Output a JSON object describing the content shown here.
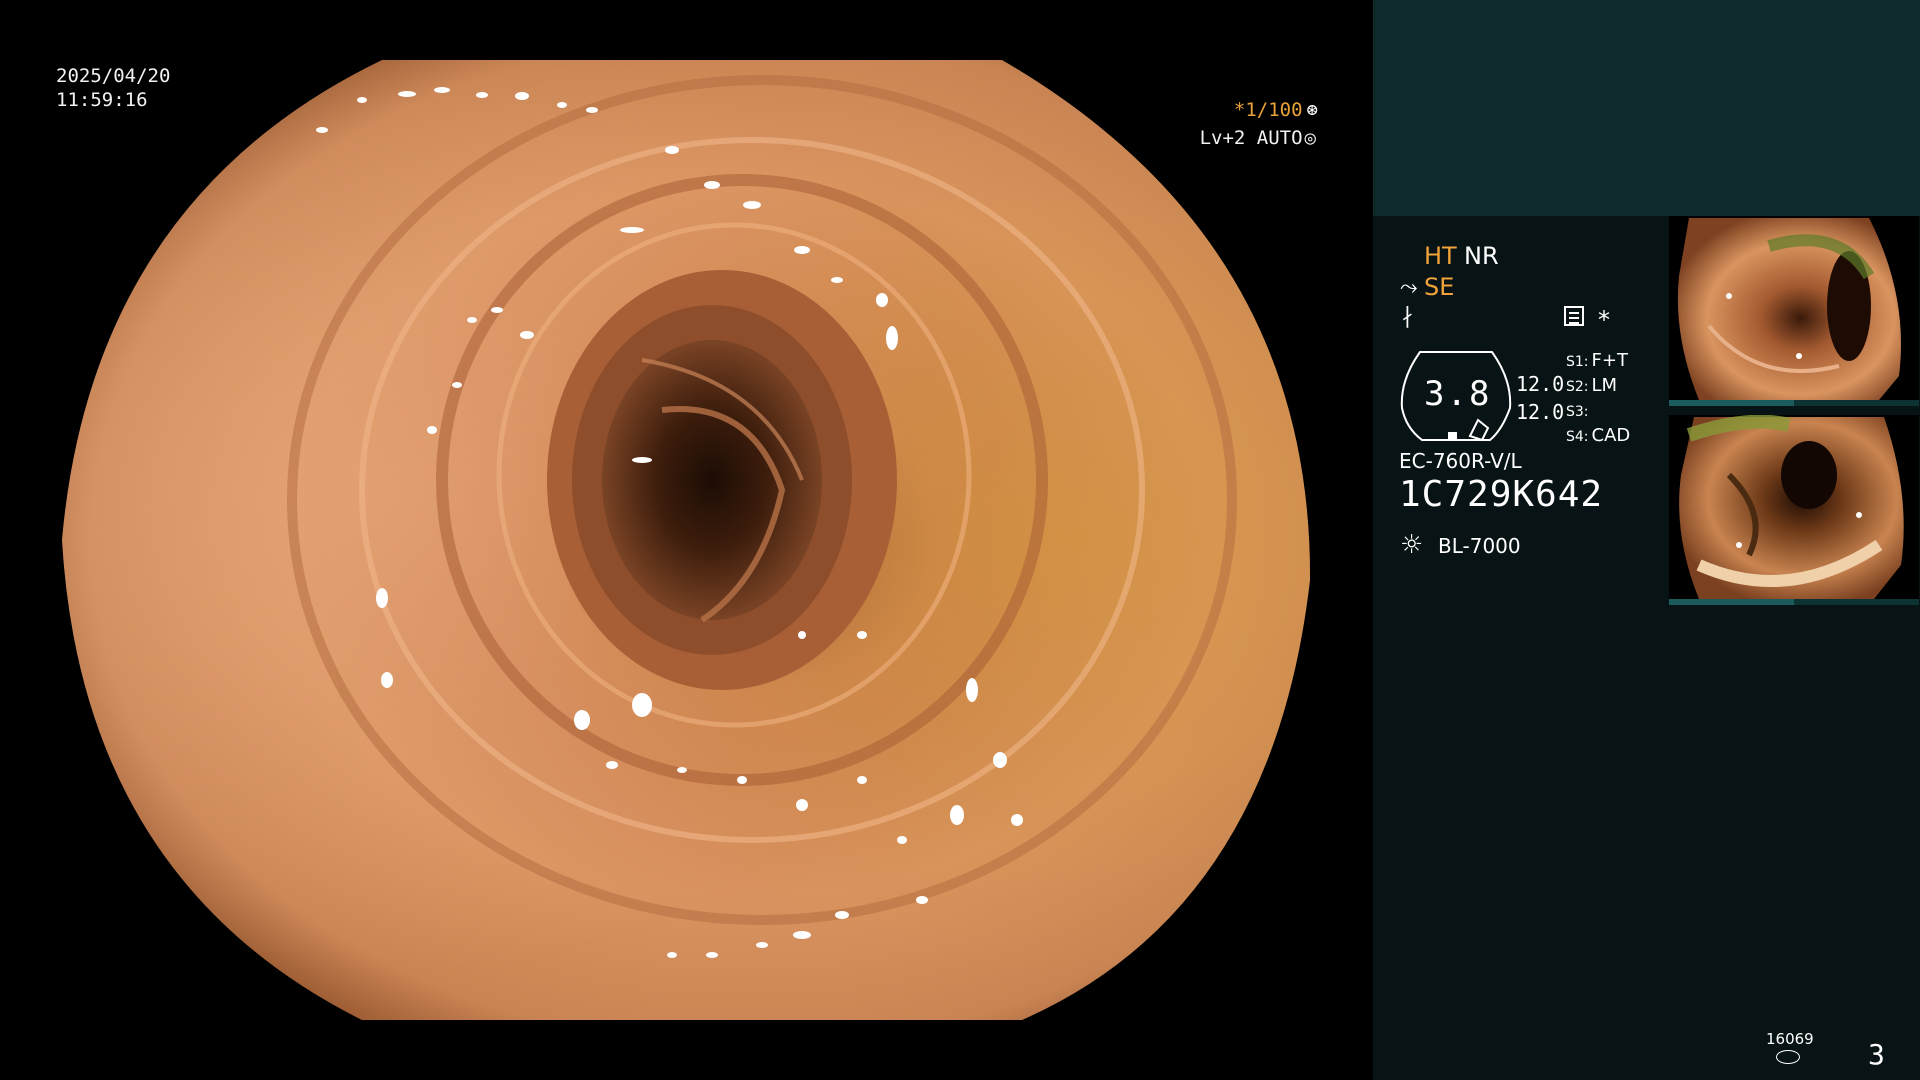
{
  "overlay": {
    "date": "2025/04/20",
    "time": "11:59:16",
    "shutter": "*1/100",
    "level": "Lv+2 AUTO"
  },
  "panel": {
    "mode_ht": "HT",
    "mode_nr": "NR",
    "mode_se": "SE",
    "gauge_value": "3.8",
    "gauge_top": "12.0",
    "gauge_bottom": "12.0",
    "switches": [
      {
        "key": "S1:",
        "value": "F+T"
      },
      {
        "key": "S2:",
        "value": "LM"
      },
      {
        "key": "S3:",
        "value": ""
      },
      {
        "key": "S4:",
        "value": "CAD"
      }
    ],
    "scope_model": "EC-760R-V/L",
    "serial": "1C729K642",
    "light_source": "BL-7000",
    "image_count": "16069",
    "page_number": "3"
  },
  "colors": {
    "accent_orange": "#f0a33a",
    "panel_bg": "#071314",
    "band_bg": "#0f2a2a"
  },
  "icons": {
    "shutter": "aperture-icon",
    "level": "iris-icon",
    "se": "structure-enhance-icon",
    "freq": "frequency-icon",
    "menu": "menu-icon",
    "light": "light-source-icon",
    "storage": "storage-disk-icon"
  }
}
